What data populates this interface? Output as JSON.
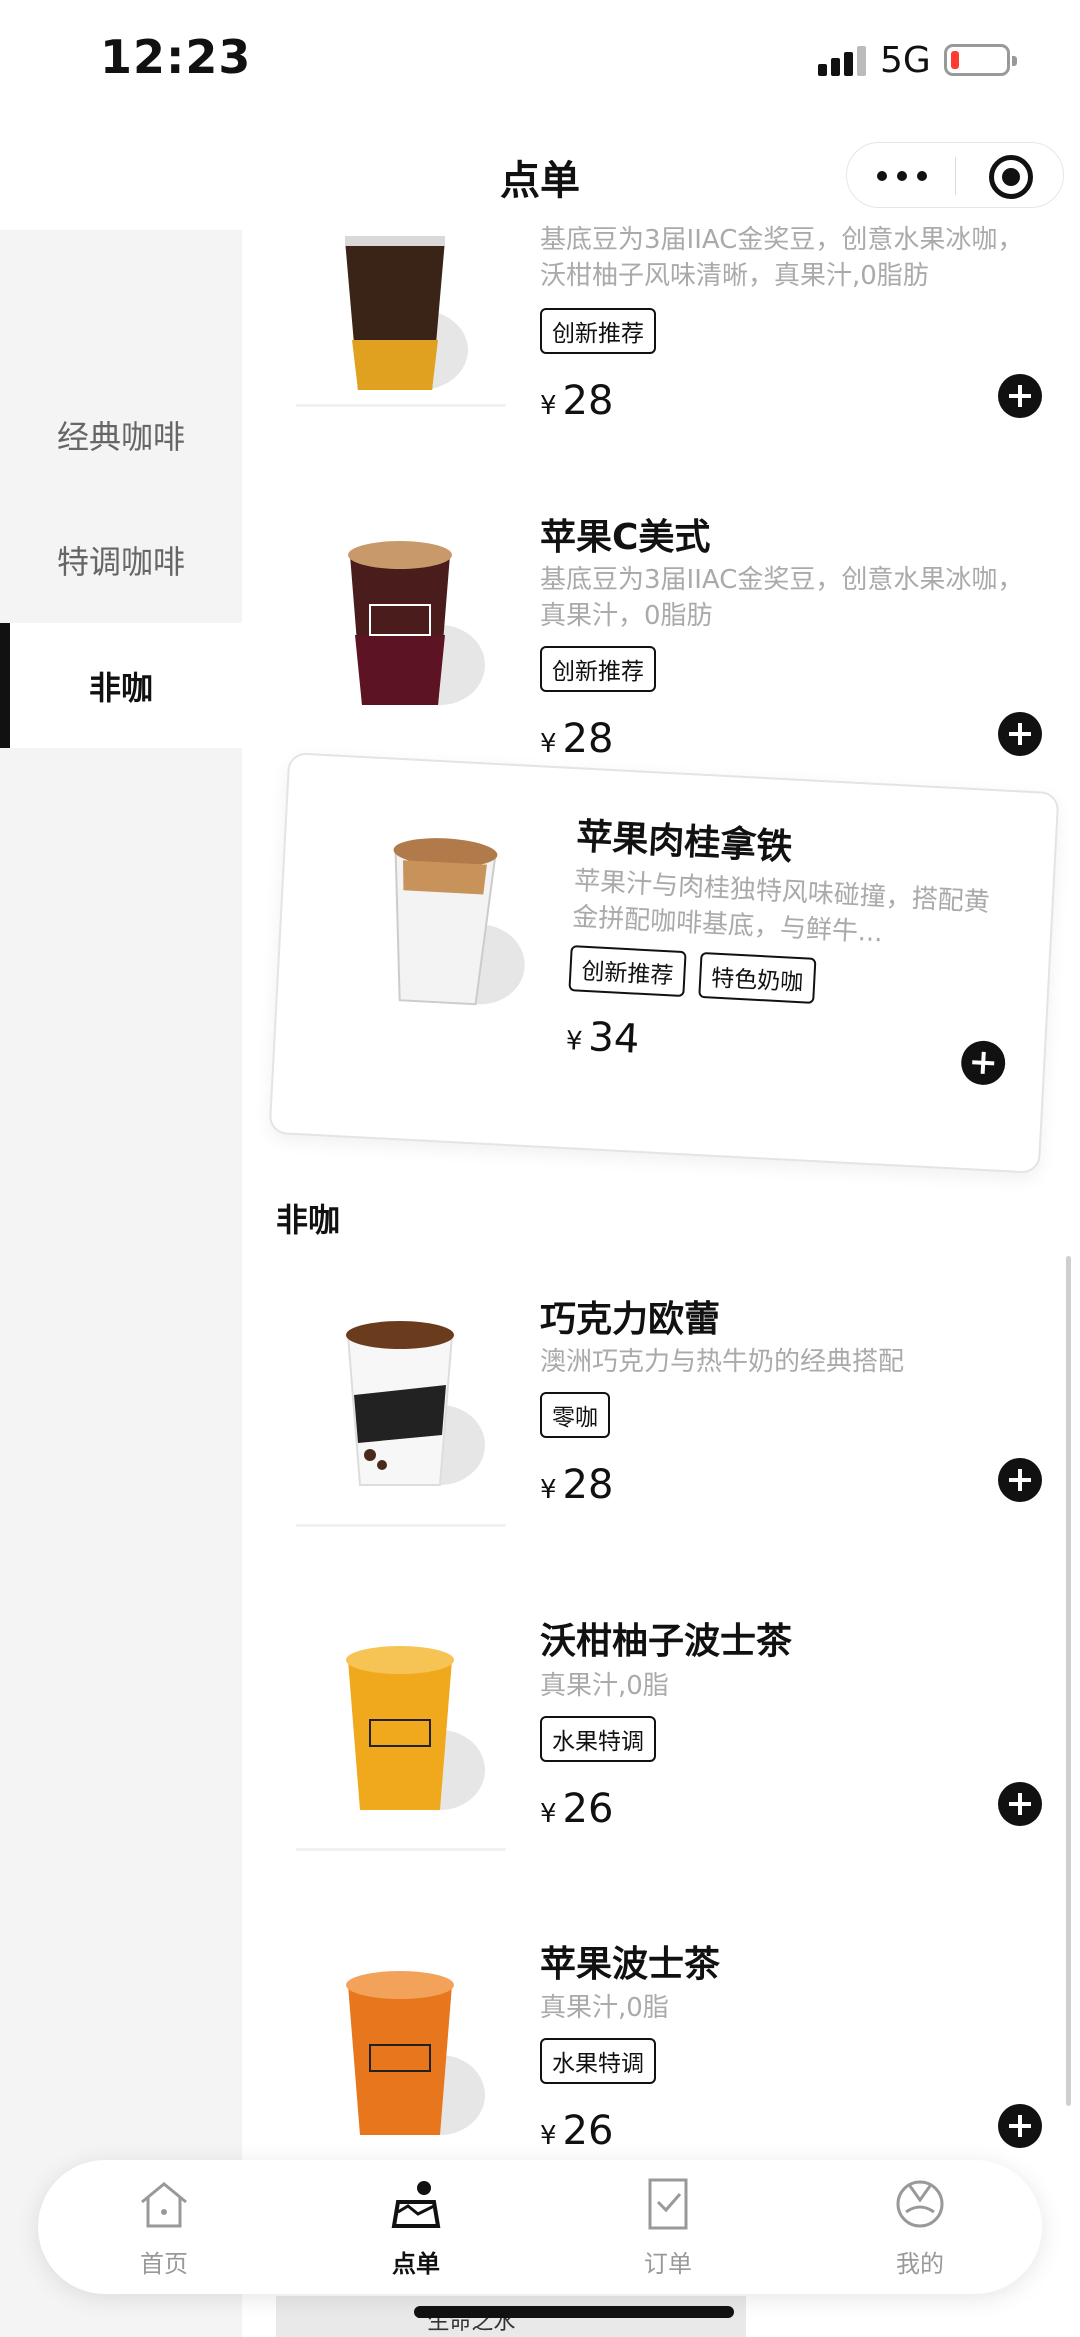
{
  "status_bar": {
    "time": "12:23",
    "network": "5G"
  },
  "navbar": {
    "title": "点单"
  },
  "sidebar": {
    "items": [
      {
        "label": "经典咖啡"
      },
      {
        "label": "特调咖啡"
      },
      {
        "label": "非咖"
      }
    ],
    "active": "非咖"
  },
  "products": [
    {
      "name": "",
      "desc": "基底豆为3届IIAC金奖豆，创意水果冰咖，沃柑柚子风味清晰，真果汁,0脂肪",
      "tags": [
        "创新推荐"
      ],
      "currency": "¥",
      "price": "28"
    },
    {
      "name": "苹果C美式",
      "desc": "基底豆为3届IIAC金奖豆，创意水果冰咖，真果汁，0脂肪",
      "tags": [
        "创新推荐"
      ],
      "currency": "¥",
      "price": "28"
    },
    {
      "name": "苹果肉桂拿铁",
      "desc": "苹果汁与肉桂独特风味碰撞，搭配黄金拼配咖啡基底，与鲜牛...",
      "tags": [
        "创新推荐",
        "特色奶咖"
      ],
      "currency": "¥",
      "price": "34"
    }
  ],
  "section": {
    "title": "非咖"
  },
  "non_coffee": [
    {
      "name": "巧克力欧蕾",
      "desc": "澳洲巧克力与热牛奶的经典搭配",
      "tags": [
        "零咖"
      ],
      "currency": "¥",
      "price": "28"
    },
    {
      "name": "沃柑柚子波士茶",
      "desc": "真果汁,0脂",
      "tags": [
        "水果特调"
      ],
      "currency": "¥",
      "price": "26"
    },
    {
      "name": "苹果波士茶",
      "desc": "真果汁,0脂",
      "tags": [
        "水果特调"
      ],
      "currency": "¥",
      "price": "26"
    }
  ],
  "banner_peek": {
    "text": "“生命之水”"
  },
  "tabbar": {
    "items": [
      {
        "label": "首页",
        "icon": "home-icon"
      },
      {
        "label": "点单",
        "icon": "order-cake-icon"
      },
      {
        "label": "订单",
        "icon": "receipt-icon"
      },
      {
        "label": "我的",
        "icon": "profile-icon"
      }
    ],
    "active": "点单"
  },
  "colors": {
    "accent": "#111111",
    "sidebar_bg": "#f4f4f4",
    "desc_text": "#aaaaaa",
    "battery_low": "#ff3b30"
  }
}
